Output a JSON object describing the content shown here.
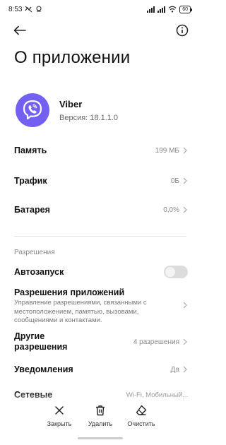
{
  "status": {
    "time": "8:53",
    "battery": "60"
  },
  "title": "О приложении",
  "app": {
    "name": "Viber",
    "version": "Версия: 18.1.1.0",
    "icon": "viber-icon",
    "brand_color": "#7360f2"
  },
  "storage": {
    "label": "Память",
    "value": "199 МБ"
  },
  "traffic": {
    "label": "Трафик",
    "value": "0Б"
  },
  "battery_usage": {
    "label": "Батарея",
    "value": "0,0%"
  },
  "permissions_section": "Разрешения",
  "autostart": {
    "label": "Автозапуск",
    "enabled": false
  },
  "app_permissions": {
    "title": "Разрешения приложений",
    "description": "Управление разрешениями, связанными с местоположением, памятью, вызовами, сообщениями и контактами."
  },
  "other_permissions": {
    "label": "Другие разрешения",
    "value": "4 разрешения"
  },
  "notifications": {
    "label": "Уведомления",
    "value": "Да"
  },
  "network": {
    "label": "Сетевые",
    "value": "Wi-Fi, Мобильный..."
  },
  "bottom_actions": {
    "close": "Закрыть",
    "delete": "Удалить",
    "clear": "Очистить"
  }
}
